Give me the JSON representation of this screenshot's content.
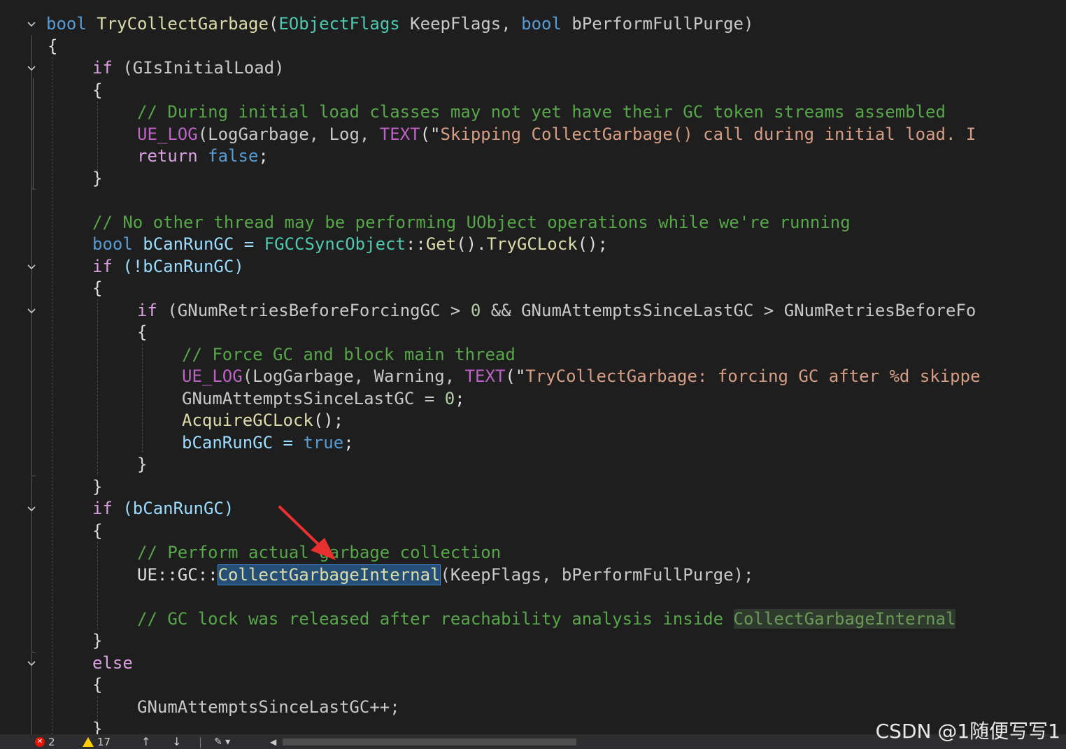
{
  "code": {
    "l1": {
      "t1": "bool",
      "t2": "TryCollectGarbage",
      "t3": "(",
      "t4": "EObjectFlags",
      "t5": " KeepFlags, ",
      "t6": "bool",
      "t7": " bPerformFullPurge)"
    },
    "l2": {
      "t1": "{"
    },
    "l3": {
      "t1": "if",
      "t2": " (GIsInitialLoad)"
    },
    "l4": {
      "t1": "{"
    },
    "l5": {
      "t1": "// During initial load classes may not yet have their GC token streams assembled"
    },
    "l6": {
      "t1": "UE_LOG",
      "t2": "(LogGarbage, Log, ",
      "t3": "TEXT",
      "t4": "(\"",
      "t5": "Skipping CollectGarbage() call during initial load. I"
    },
    "l7": {
      "t1": "return",
      "t2": " ",
      "t3": "false",
      "t4": ";"
    },
    "l8": {
      "t1": "}"
    },
    "l9": {
      "t1": "// No other thread may be performing UObject operations while we're running"
    },
    "l10": {
      "t1": "bool",
      "t2": " bCanRunGC = ",
      "t3": "FGCCSyncObject",
      "t4": "::",
      "t5": "Get",
      "t6": "().",
      "t7": "TryGCLock",
      "t8": "();"
    },
    "l11": {
      "t1": "if",
      "t2": " (!bCanRunGC)"
    },
    "l12": {
      "t1": "{"
    },
    "l13": {
      "t1": "if",
      "t2": " (GNumRetriesBeforeForcingGC > ",
      "t3": "0",
      "t4": " && GNumAttemptsSinceLastGC > GNumRetriesBeforeFo"
    },
    "l14": {
      "t1": "{"
    },
    "l15": {
      "t1": "// Force GC and block main thread"
    },
    "l16": {
      "t1": "UE_LOG",
      "t2": "(LogGarbage, Warning, ",
      "t3": "TEXT",
      "t4": "(\"",
      "t5": "TryCollectGarbage: forcing GC after %d skippe"
    },
    "l17": {
      "t1": "GNumAttemptsSinceLastGC = ",
      "t2": "0",
      ";": ";",
      "t3": ";"
    },
    "l18": {
      "t1": "AcquireGCLock",
      "t2": "();"
    },
    "l19": {
      "t1": "bCanRunGC = ",
      "t2": "true",
      "t3": ";"
    },
    "l20": {
      "t1": "}"
    },
    "l21": {
      "t1": "}"
    },
    "l22": {
      "t1": "if",
      "t2": " (bCanRunGC)"
    },
    "l23": {
      "t1": "{"
    },
    "l24": {
      "t1": "// Perform actual garbage collection"
    },
    "l25": {
      "t1": "UE::GC::",
      "t2": "CollectGarbageInternal",
      "t3": "(KeepFlags, bPerformFullPurge);"
    },
    "l26": {
      "t1": "// GC lock was released after reachability analysis inside ",
      "t2": "CollectGarbageInternal"
    },
    "l27": {
      "t1": "}"
    },
    "l28": {
      "t1": "else"
    },
    "l29": {
      "t1": "{"
    },
    "l30": {
      "t1": "GNumAttemptsSinceLastGC++;"
    },
    "l31": {
      "t1": "}"
    }
  },
  "status": {
    "errors": "2",
    "warnings": "17"
  },
  "watermark": "CSDN @1随便写写1",
  "colors": {
    "background": "#1e1e1e",
    "keyword": "#569cd6",
    "control": "#d8a0df",
    "function": "#dcdcaa",
    "type": "#4ec9b0",
    "comment": "#57a64a",
    "string": "#d69d85",
    "selection": "#264f78",
    "arrow": "#e8312f"
  }
}
